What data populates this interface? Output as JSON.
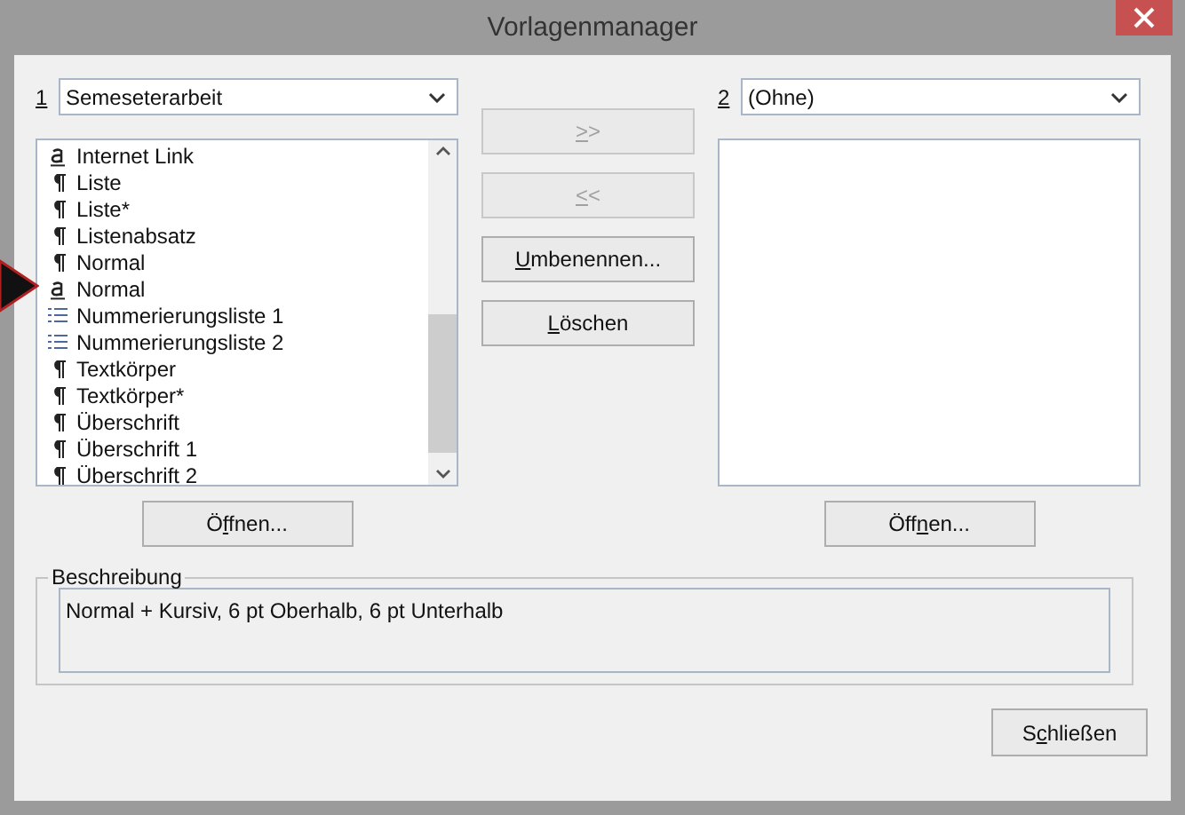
{
  "window": {
    "title": "Vorlagenmanager"
  },
  "left": {
    "number": "1",
    "dropdown": "Semeseterarbeit",
    "styles": [
      {
        "kind": "character",
        "name": "Internet Link"
      },
      {
        "kind": "paragraph",
        "name": "Liste"
      },
      {
        "kind": "paragraph",
        "name": "Liste*"
      },
      {
        "kind": "paragraph",
        "name": "Listenabsatz"
      },
      {
        "kind": "paragraph",
        "name": "Normal"
      },
      {
        "kind": "character",
        "name": "Normal"
      },
      {
        "kind": "list",
        "name": "Nummerierungsliste 1"
      },
      {
        "kind": "list",
        "name": "Nummerierungsliste 2"
      },
      {
        "kind": "paragraph",
        "name": "Textkörper"
      },
      {
        "kind": "paragraph",
        "name": "Textkörper*"
      },
      {
        "kind": "paragraph",
        "name": "Überschrift"
      },
      {
        "kind": "paragraph",
        "name": "Überschrift 1"
      },
      {
        "kind": "paragraph",
        "name": "Überschrift 2"
      }
    ],
    "open_button": [
      "Ö",
      "f",
      "fnen..."
    ]
  },
  "right": {
    "number": "2",
    "dropdown": "(Ohne)",
    "open_button": [
      "Öff",
      "n",
      "en..."
    ]
  },
  "middle_buttons": [
    {
      "key": ">",
      "rest": ">",
      "disabled": true
    },
    {
      "key": "<",
      "rest": "<",
      "disabled": true
    },
    {
      "key": "U",
      "rest": "mbenennen...",
      "disabled": false
    },
    {
      "key": "L",
      "rest": "öschen",
      "disabled": false
    }
  ],
  "description": {
    "legend": "Beschreibung",
    "text": "Normal + Kursiv, 6 pt Oberhalb, 6 pt Unterhalb"
  },
  "close_button": [
    "S",
    "c",
    "hließen"
  ]
}
